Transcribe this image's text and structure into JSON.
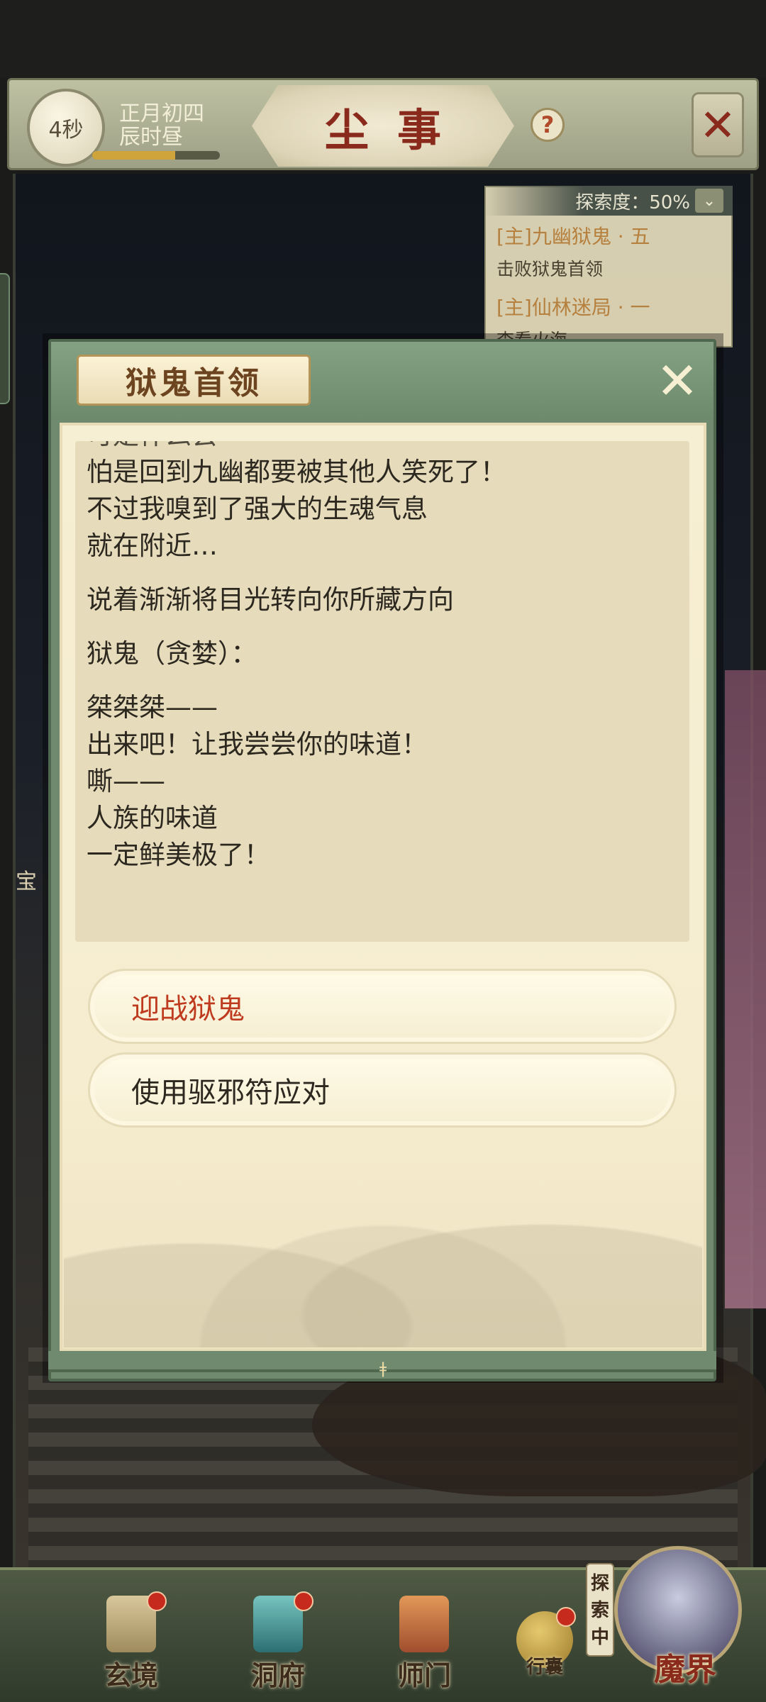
{
  "header": {
    "timer_text": "4秒",
    "date_line1": "正月初四",
    "date_line2": "辰时昼",
    "time_progress": 0.65,
    "title": "尘事",
    "help_icon": "?"
  },
  "explore": {
    "label": "探索度：50%",
    "quests": [
      {
        "title": "[主]九幽狱鬼 · 五",
        "desc": "击败狱鬼首领"
      },
      {
        "title": "[主]仙林迷局 · 一",
        "desc": "查看火海"
      }
    ]
  },
  "modal": {
    "title": "狱鬼首领",
    "dialogue": {
      "partial_top": "可是什么会",
      "block1": [
        "怕是回到九幽都要被其他人笑死了！",
        "不过我嗅到了强大的生魂气息",
        "就在附近…"
      ],
      "narration": "说着渐渐将目光转向你所藏方向",
      "speaker": "狱鬼（贪婪）：",
      "block2": [
        "桀桀桀——",
        "出来吧！让我尝尝你的味道！",
        "嘶——",
        "人族的味道",
        "一定鲜美极了！"
      ]
    },
    "choices": [
      "迎战狱鬼",
      "使用驱邪符应对"
    ]
  },
  "side": {
    "char": "宝"
  },
  "nav": {
    "items": [
      "玄境",
      "洞府",
      "师门"
    ],
    "bag": "行囊",
    "explore_tag": [
      "探",
      "索",
      "中"
    ],
    "demon": "魔界"
  },
  "colors": {
    "choice_primary": "#bf3b1f",
    "title_red": "#8a2a1d",
    "modal_frame": "#6f8a6f"
  }
}
